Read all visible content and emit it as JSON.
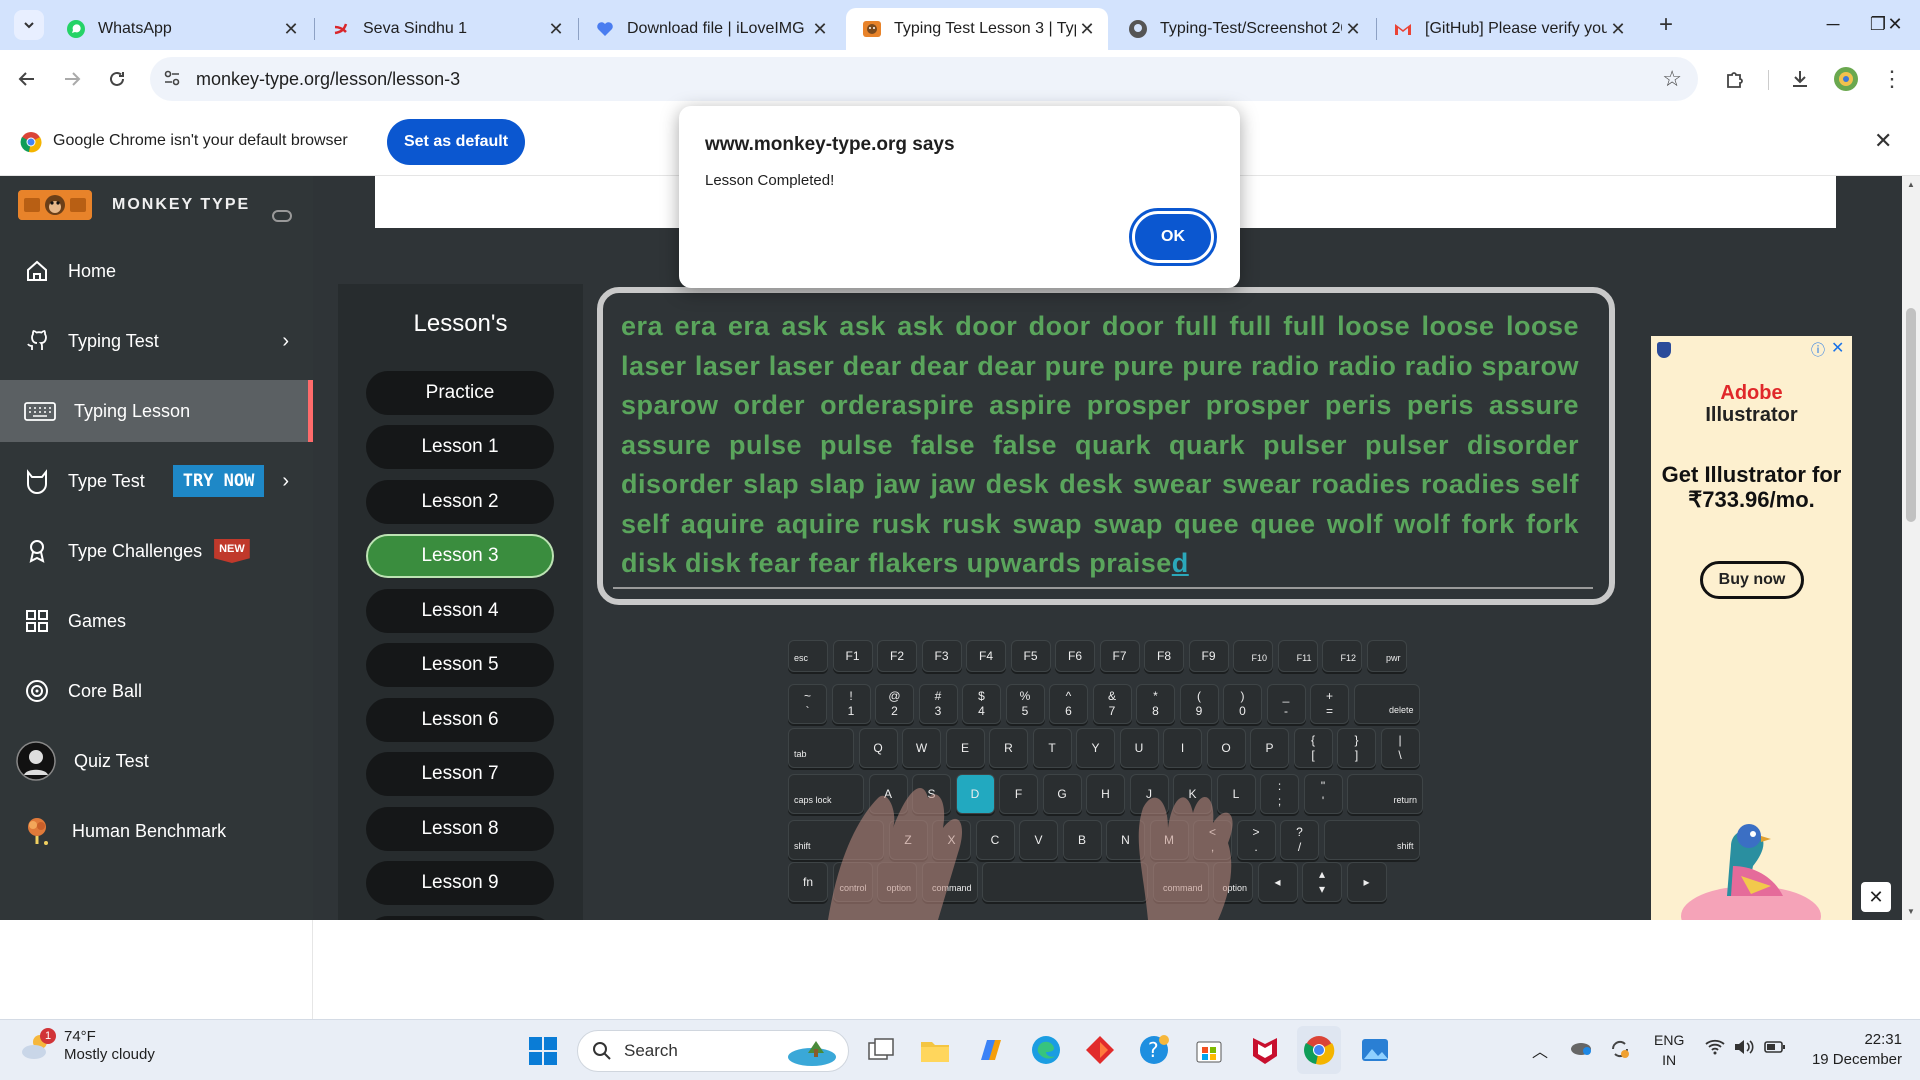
{
  "browser": {
    "tabs": [
      {
        "title": "WhatsApp",
        "icon": "whatsapp-icon"
      },
      {
        "title": "Seva Sindhu 1",
        "icon": "seva-sindhu-icon"
      },
      {
        "title": "Download file | iLoveIMG",
        "icon": "iloveimg-icon"
      },
      {
        "title": "Typing Test Lesson 3 | Typi",
        "icon": "monkey-type-icon",
        "active": true
      },
      {
        "title": "Typing-Test/Screenshot 20",
        "icon": "github-icon"
      },
      {
        "title": "[GitHub] Please verify your",
        "icon": "gmail-icon"
      }
    ],
    "url": "monkey-type.org/lesson/lesson-3",
    "infobar": {
      "message": "Google Chrome isn't your default browser",
      "button": "Set as default"
    }
  },
  "dialog": {
    "origin": "www.monkey-type.org says",
    "message": "Lesson Completed!",
    "ok_label": "OK"
  },
  "sidebar": {
    "brand": "MONKEY TYPE",
    "items": [
      {
        "label": "Home",
        "icon": "home-icon"
      },
      {
        "label": "Typing Test",
        "icon": "github-cat-icon",
        "chevron": true
      },
      {
        "label": "Typing Lesson",
        "icon": "keyboard-icon",
        "active": true
      },
      {
        "label": "Type Test",
        "icon": "cat-icon",
        "badge": "TRY NOW",
        "chevron": true
      },
      {
        "label": "Type Challenges",
        "icon": "award-icon",
        "badge": "NEW"
      },
      {
        "label": "Games",
        "icon": "grid-icon"
      },
      {
        "label": "Core Ball",
        "icon": "target-icon"
      },
      {
        "label": "Quiz Test",
        "icon": "quiz-avatar-icon"
      },
      {
        "label": "Human Benchmark",
        "icon": "brain-icon"
      }
    ]
  },
  "lessons": {
    "title": "Lesson's",
    "items": [
      "Practice",
      "Lesson 1",
      "Lesson 2",
      "Lesson 3",
      "Lesson 4",
      "Lesson 5",
      "Lesson 6",
      "Lesson 7",
      "Lesson 8",
      "Lesson 9"
    ],
    "active": "Lesson 3"
  },
  "typing": {
    "text": "era era era ask ask ask door door door full full full loose loose loose laser laser laser dear dear dear pure pure pure radio radio radio sparow sparow order orderaspire aspire prosper prosper peris peris assure assure pulse pulse false false quark quark pulser pulser disorder disorder slap slap jaw jaw desk desk swear swear roadies roadies self self aquire aquire rusk rusk swap swap quee quee wolf wolf fork fork disk disk fear fear flakers upwards praise",
    "cursor_char": "d"
  },
  "keyboard": {
    "highlighted_key": "D",
    "rows": [
      [
        "esc",
        "F1",
        "F2",
        "F3",
        "F4",
        "F5",
        "F6",
        "F7",
        "F8",
        "F9",
        "F10",
        "F11",
        "F12",
        "pwr"
      ],
      [
        "~\n`",
        "!\n1",
        "@\n2",
        "#\n3",
        "$\n4",
        "%\n5",
        "^\n6",
        "&\n7",
        "*\n8",
        "(\n9",
        ")\n0",
        "_\n-",
        "+\n=",
        "delete"
      ],
      [
        "tab",
        "Q",
        "W",
        "E",
        "R",
        "T",
        "Y",
        "U",
        "I",
        "O",
        "P",
        "{\n[",
        "}\n]",
        "|\n\\"
      ],
      [
        "caps lock",
        "A",
        "S",
        "D",
        "F",
        "G",
        "H",
        "J",
        "K",
        "L",
        ":\n;",
        "\"\n'",
        "return"
      ],
      [
        "shift",
        "Z",
        "X",
        "C",
        "V",
        "B",
        "N",
        "M",
        "<\n,",
        ">\n.",
        "?\n/",
        "shift"
      ],
      [
        "fn",
        "control",
        "option",
        "command",
        "",
        "command",
        "option",
        "◂",
        "▴\n▾",
        "▸"
      ]
    ]
  },
  "ad": {
    "brand_line1": "Adobe",
    "brand_line2": "Illustrator",
    "headline": "Get Illustrator for ₹733.96/mo.",
    "cta": "Buy now"
  },
  "taskbar": {
    "weather_temp": "74°F",
    "weather_desc": "Mostly cloudy",
    "weather_badge": "1",
    "search_label": "Search",
    "lang_top": "ENG",
    "lang_bottom": "IN",
    "time": "22:31",
    "date": "19 December"
  }
}
